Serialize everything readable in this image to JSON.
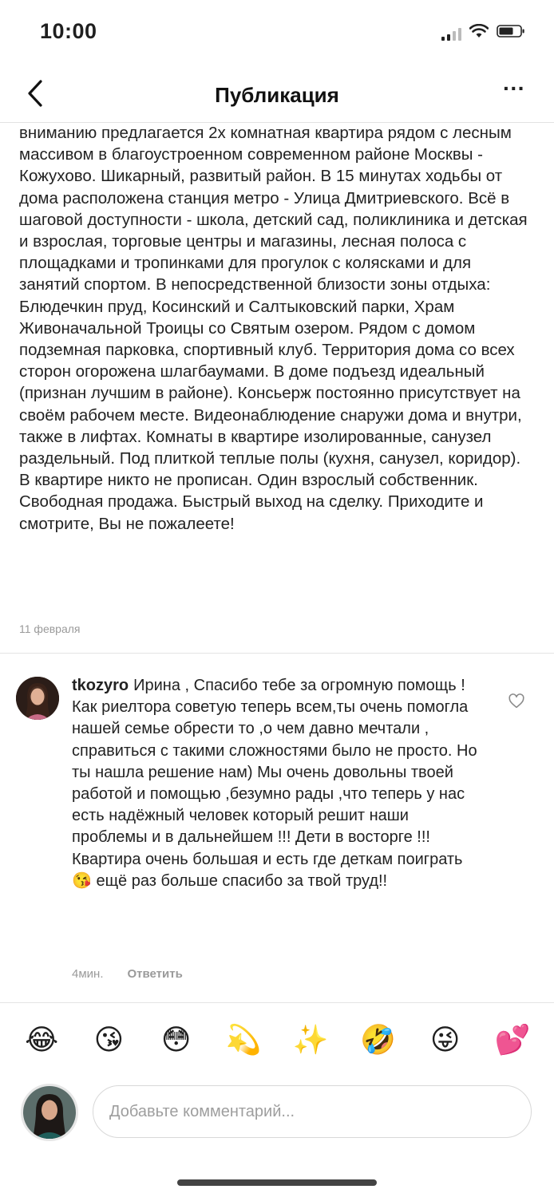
{
  "status_bar": {
    "time": "10:00",
    "icons": [
      "signal-icon",
      "wifi-icon",
      "battery-icon"
    ]
  },
  "header": {
    "title": "Публикация",
    "back_icon": "chevron-left-icon",
    "more_label": "···"
  },
  "post": {
    "caption": "вниманию предлагается 2х комнатная квартира рядом с лесным массивом в благоустроенном современном районе Москвы - Кожухово. Шикарный, развитый район. В 15 минутах ходьбы от дома расположена станция метро - Улица Дмитриевского. Всё в шаговой доступности - школа, детский сад, поликлиника и детская и взрослая, торговые центры и магазины, лесная полоса с площадками и тропинками для прогулок с колясками и для занятий спортом. В непосредственной близости зоны отдыха: Блюдечкин пруд, Косинский и Салтыковский парки, Храм Живоначальной Троицы со Святым озером. Рядом с домом подземная парковка, спортивный клуб. Территория дома со всех сторон огорожена шлагбаумами. В доме подъезд идеальный (признан лучшим в районе). Консьерж постоянно присутствует на своём рабочем месте. Видеонаблюдение снаружи дома и внутри, также в лифтах. Комнаты в квартире изолированные, санузел раздельный. Под плиткой теплые полы (кухня, санузел, коридор). В квартире никто не прописан. Один взрослый собственник. Свободная продажа. Быстрый выход на сделку. Приходите и смотрите, Вы не пожалеете!",
    "date": "11 февраля"
  },
  "comment": {
    "username": "tkozyro",
    "text": "Ирина , Спасибо тебе за огромную помощь ! Как риелтора советую теперь всем,ты очень помогла нашей семье обрести то ,о чем давно мечтали , справиться с такими сложностями было не просто. Но ты  нашла решение нам) Мы очень довольны твоей работой и помощью ,безумно рады ,что теперь у нас есть надёжный человек который решит наши проблемы и в дальнейшем !!! Дети в восторге !!! Квартира очень  большая и есть где деткам поиграть 😘 ещё раз больше спасибо за твой труд!!",
    "time": "4мин.",
    "reply_label": "Ответить",
    "like_icon": "heart-outline-icon"
  },
  "emoji_bar": [
    "😂",
    "😘",
    "😳",
    "💫",
    "✨",
    "🤣",
    "😜",
    "💕"
  ],
  "composer": {
    "placeholder": "Добавьте комментарий..."
  },
  "colors": {
    "text": "#222222",
    "secondary": "#9a9a9a",
    "divider": "#e4e4e4"
  }
}
